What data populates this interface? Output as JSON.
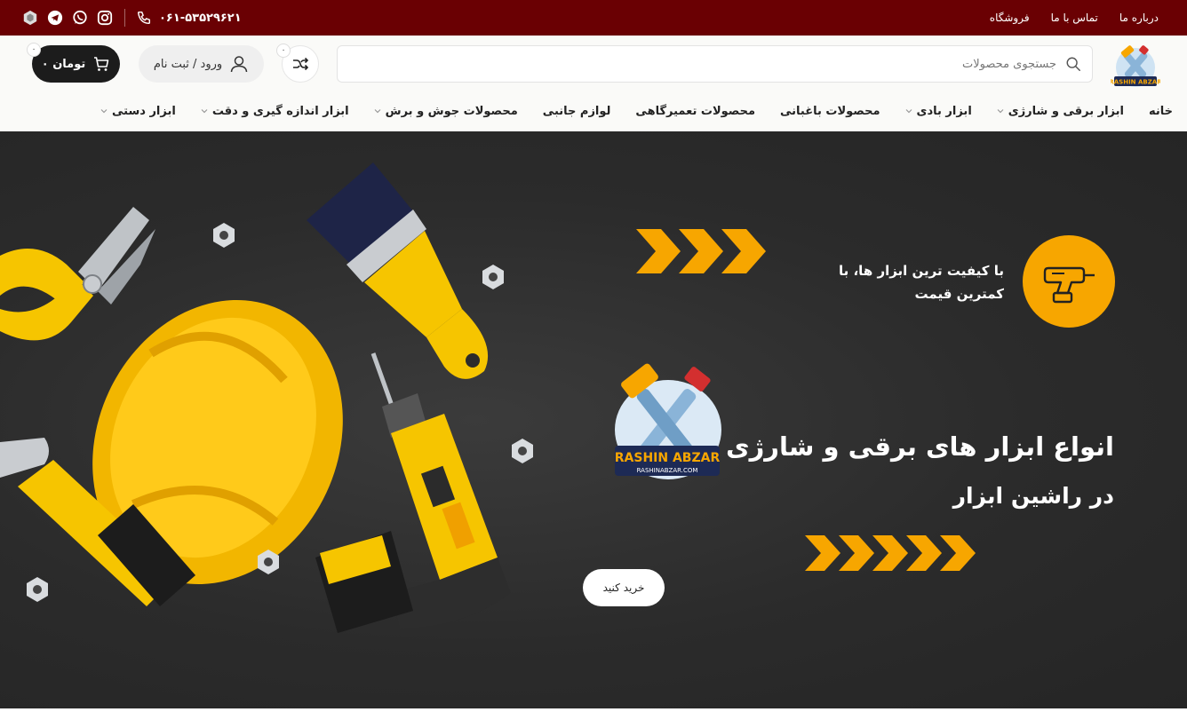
{
  "topbar": {
    "links": [
      "درباره ما",
      "تماس با ما",
      "فروشگاه"
    ],
    "phone": "۰۶۱-۵۳۵۲۹۶۲۱",
    "social_icons": [
      "instagram-icon",
      "whatsapp-icon",
      "telegram-icon",
      "rubika-icon"
    ]
  },
  "header": {
    "logo_alt": "RASHIN ABZAR",
    "search_placeholder": "جستجوی محصولات",
    "compare_count": "۰",
    "login_label": "ورود / ثبت نام",
    "cart_count": "۰",
    "cart_label": "۰ تومان"
  },
  "nav": {
    "items": [
      {
        "label": "خانه",
        "dropdown": false
      },
      {
        "label": "ابزار برقی و شارژی",
        "dropdown": true
      },
      {
        "label": "ابزار بادی",
        "dropdown": true
      },
      {
        "label": "محصولات باغبانی",
        "dropdown": false
      },
      {
        "label": "محصولات تعمیرگاهی",
        "dropdown": false
      },
      {
        "label": "لوازم جانبی",
        "dropdown": false
      },
      {
        "label": "محصولات جوش و برش",
        "dropdown": true
      },
      {
        "label": "ابزار اندازه گیری و دقت",
        "dropdown": true
      },
      {
        "label": "ابزار دستی",
        "dropdown": true
      }
    ]
  },
  "hero": {
    "tagline": "با کیفیت ترین ابزار ها، با کمترین قیمت",
    "title": "انواع ابزار های برقی و شارژی",
    "subtitle": "در راشین ابزار",
    "button": "خرید کنید",
    "logo_text": "RASHIN ABZAR",
    "logo_url_text": "RASHINABZAR.COM"
  },
  "colors": {
    "topbar": "#6a0003",
    "accent": "#f7a600",
    "hero_bg": "#2b2b2b",
    "cart_bg": "#1c1c1c"
  }
}
